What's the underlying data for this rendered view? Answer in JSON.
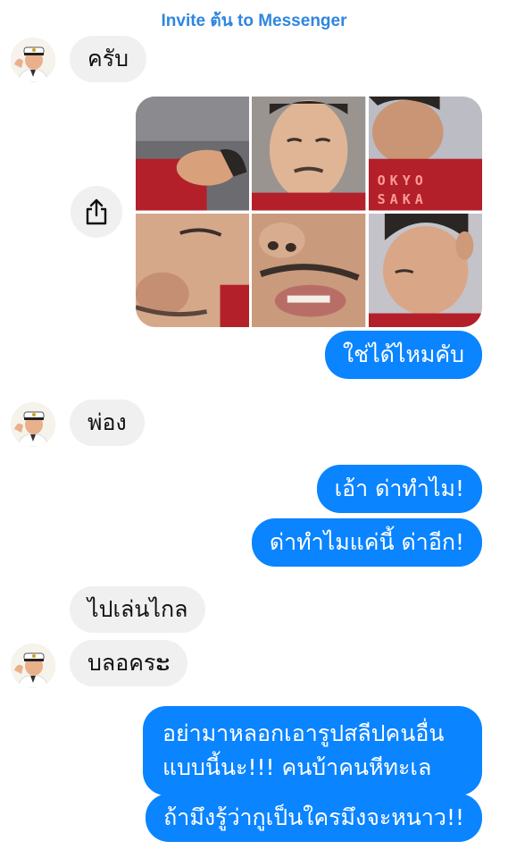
{
  "header": {
    "invite_text": "Invite ต้น to Messenger"
  },
  "contact": {
    "avatar_icon": "sailor-man-avatar"
  },
  "messages": [
    {
      "from": "them",
      "text": "ครับ"
    },
    {
      "from": "them",
      "type": "photos",
      "count": 6,
      "shirt_text_line1": "OKYO",
      "shirt_text_line2": "SAKA"
    },
    {
      "from": "me",
      "text": "ใช่ได้ไหมคับ"
    },
    {
      "from": "them",
      "text": "พ่อง"
    },
    {
      "from": "me",
      "text": "เอ้า ด่าทำไม!"
    },
    {
      "from": "me",
      "text": "ด่าทำไมแค่นี้ ด่าอีก!"
    },
    {
      "from": "them",
      "text": "ไปเล่นไกล"
    },
    {
      "from": "them",
      "text": "บลอครະ"
    },
    {
      "from": "me",
      "text": "อย่ามาหลอกเอารูปสลีปคนอื่นแบบนี้นะ!!! คนบ้าคนหีทะเล"
    },
    {
      "from": "me",
      "text": "ถ้ามึงรู้ว่ากูเป็นใครมึงจะหนาว!!"
    }
  ],
  "share": {
    "icon": "share-icon"
  },
  "colors": {
    "outgoing": "#0a84ff",
    "incoming": "#f1f0f0",
    "link": "#2f86e0"
  }
}
